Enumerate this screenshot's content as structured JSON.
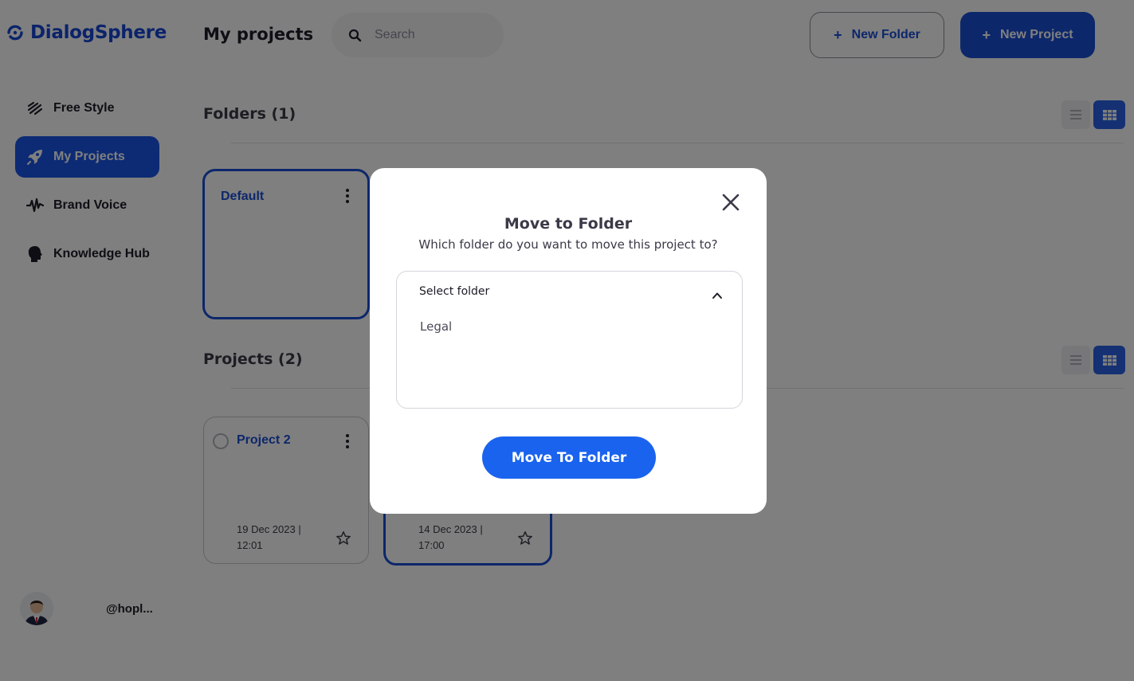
{
  "brand": {
    "name": "DialogSphere",
    "color": "#1647d6"
  },
  "header": {
    "title": "My projects",
    "search_placeholder": "Search",
    "new_folder_label": "New Folder",
    "new_project_label": "New Project",
    "plus_glyph": "+"
  },
  "sidebar": {
    "items": [
      {
        "label": "Free Style",
        "icon": "pen-strokes-icon",
        "active": false
      },
      {
        "label": "My Projects",
        "icon": "rocket-icon",
        "active": true
      },
      {
        "label": "Brand Voice",
        "icon": "waveform-icon",
        "active": false
      },
      {
        "label": "Knowledge Hub",
        "icon": "head-profile-icon",
        "active": false
      }
    ],
    "username": "@hopl..."
  },
  "folders": {
    "title": "Folders (1)",
    "items": [
      {
        "name": "Default"
      }
    ]
  },
  "projects": {
    "title": "Projects (2)",
    "items": [
      {
        "name": "Project 2",
        "date": "19 Dec 2023 |",
        "time": "12:01"
      },
      {
        "name": "",
        "date": "14 Dec 2023 |",
        "time": "17:00"
      }
    ]
  },
  "modal": {
    "title": "Move to Folder",
    "subtitle": "Which folder do you want to move this project to?",
    "select_label": "Select folder",
    "options": [
      "Legal"
    ],
    "submit_label": "Move To Folder"
  },
  "colors": {
    "accent": "#1a4fd6",
    "button_primary": "#1a63ee",
    "overlay": "rgba(0,0,0,0.5)"
  }
}
